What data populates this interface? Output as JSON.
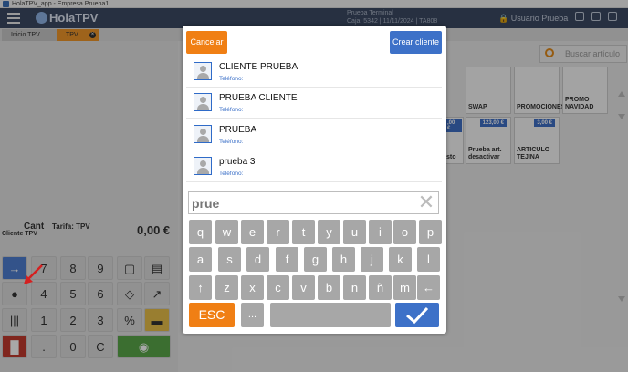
{
  "window": {
    "title": "HolaTPV_app - Empresa Prueba1"
  },
  "header": {
    "logo": "HolaTPV",
    "terminal_line1": "Prueba Terminal",
    "terminal_line2": "Caja: 5342 | 11/11/2024 | TA808",
    "user": "Usuario Prueba"
  },
  "tabs": [
    {
      "label": "Inicio TPV"
    },
    {
      "label": "TPV"
    }
  ],
  "ticket": {
    "cant_label": "Cant",
    "tarifa": "Tarifa: TPV",
    "cliente": "Cliente TPV",
    "total": "0,00 €"
  },
  "keypad": {
    "k7": "7",
    "k8": "8",
    "k9": "9",
    "k4": "4",
    "k5": "5",
    "k6": "6",
    "k1": "1",
    "k2": "2",
    "k3": "3",
    "k0": ".",
    "k00": "0",
    "kc": "C"
  },
  "search": {
    "placeholder": "Buscar artículo"
  },
  "tiles": [
    {
      "label": "SWAP",
      "price": ""
    },
    {
      "label": "PROMOCIONES",
      "price": ""
    },
    {
      "label": "PROMO NAVIDAD",
      "price": ""
    },
    {
      "label": "Prueba art. desactivar",
      "price": "123,00 €"
    },
    {
      "label": "ARTICULO TEJINA",
      "price": "3,00 €"
    },
    {
      "label": "sto",
      "price": ",00 €"
    }
  ],
  "modal": {
    "cancel_label": "Cancelar",
    "create_label": "Crear cliente",
    "clients": [
      {
        "name": "CLIENTE PRUEBA",
        "phone_label": "Teléfono:"
      },
      {
        "name": "PRUEBA CLIENTE",
        "phone_label": "Teléfono:"
      },
      {
        "name": "PRUEBA",
        "phone_label": "Teléfono:"
      },
      {
        "name": "prueba 3",
        "phone_label": "Teléfono:"
      }
    ],
    "search_value": "prue",
    "keyboard": {
      "row1": [
        "q",
        "w",
        "e",
        "r",
        "t",
        "y",
        "u",
        "i",
        "o",
        "p"
      ],
      "row2": [
        "a",
        "s",
        "d",
        "f",
        "g",
        "h",
        "j",
        "k",
        "l"
      ],
      "row3": [
        "↑",
        "z",
        "x",
        "c",
        "v",
        "b",
        "n",
        "ñ",
        "m",
        "←"
      ],
      "esc_label": "ESC",
      "dots_label": "..."
    }
  }
}
